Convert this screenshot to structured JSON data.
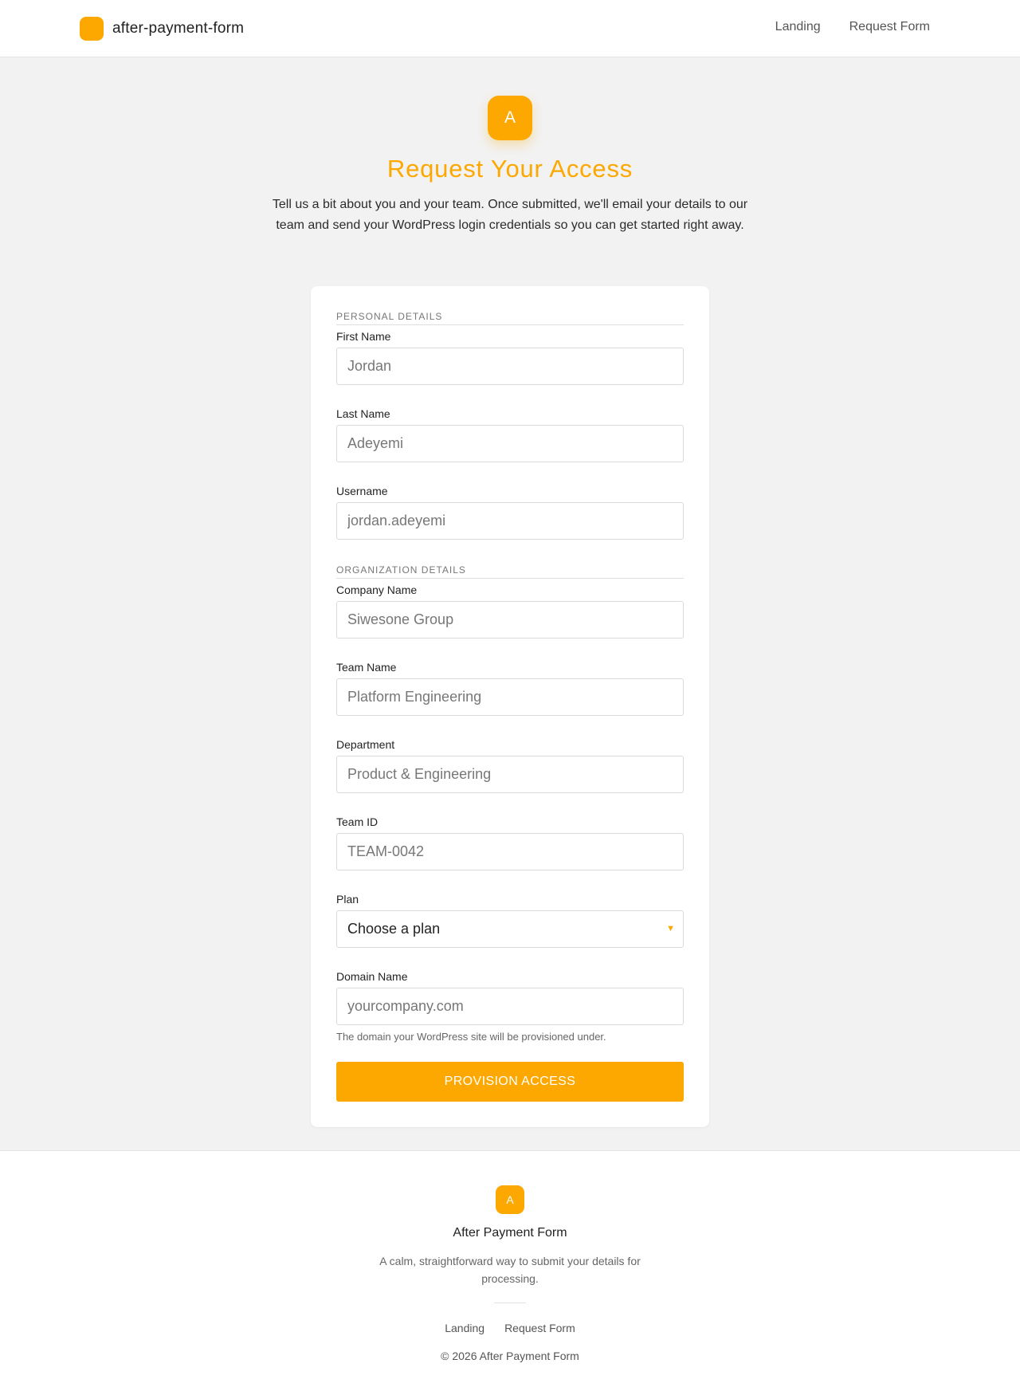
{
  "header": {
    "brand_name": "after-payment-form",
    "nav": [
      "Landing",
      "Request Form"
    ]
  },
  "hero": {
    "mark_letter": "A",
    "title": "Request Your Access",
    "description": "Tell us a bit about you and your team. Once submitted, we'll email your details to our team and send your WordPress login credentials so you can get started right away."
  },
  "form": {
    "personal_section": "PERSONAL DETAILS",
    "organization_section": "ORGANIZATION DETAILS",
    "first_name": {
      "label": "First Name",
      "placeholder": "Jordan"
    },
    "last_name": {
      "label": "Last Name",
      "placeholder": "Adeyemi"
    },
    "username": {
      "label": "Username",
      "placeholder": "jordan.adeyemi"
    },
    "company_name": {
      "label": "Company Name",
      "placeholder": "Siwesone Group"
    },
    "team_name": {
      "label": "Team Name",
      "placeholder": "Platform Engineering"
    },
    "department": {
      "label": "Department",
      "placeholder": "Product & Engineering"
    },
    "team_id": {
      "label": "Team ID",
      "placeholder": "TEAM-0042"
    },
    "plan": {
      "label": "Plan",
      "selected": "Choose a plan",
      "caret": "▼"
    },
    "domain": {
      "label": "Domain Name",
      "placeholder": "yourcompany.com",
      "hint": "The domain your WordPress site will be provisioned under."
    },
    "submit_label": "PROVISION ACCESS"
  },
  "footer": {
    "mark_letter": "A",
    "name": "After Payment Form",
    "description": "A calm, straightforward way to submit your details for processing.",
    "links": [
      "Landing",
      "Request Form"
    ],
    "copyright": "© 2026 After Payment Form"
  },
  "colors": {
    "accent": "#fda800",
    "page_background": "#f2f2f2",
    "surface": "#ffffff"
  }
}
